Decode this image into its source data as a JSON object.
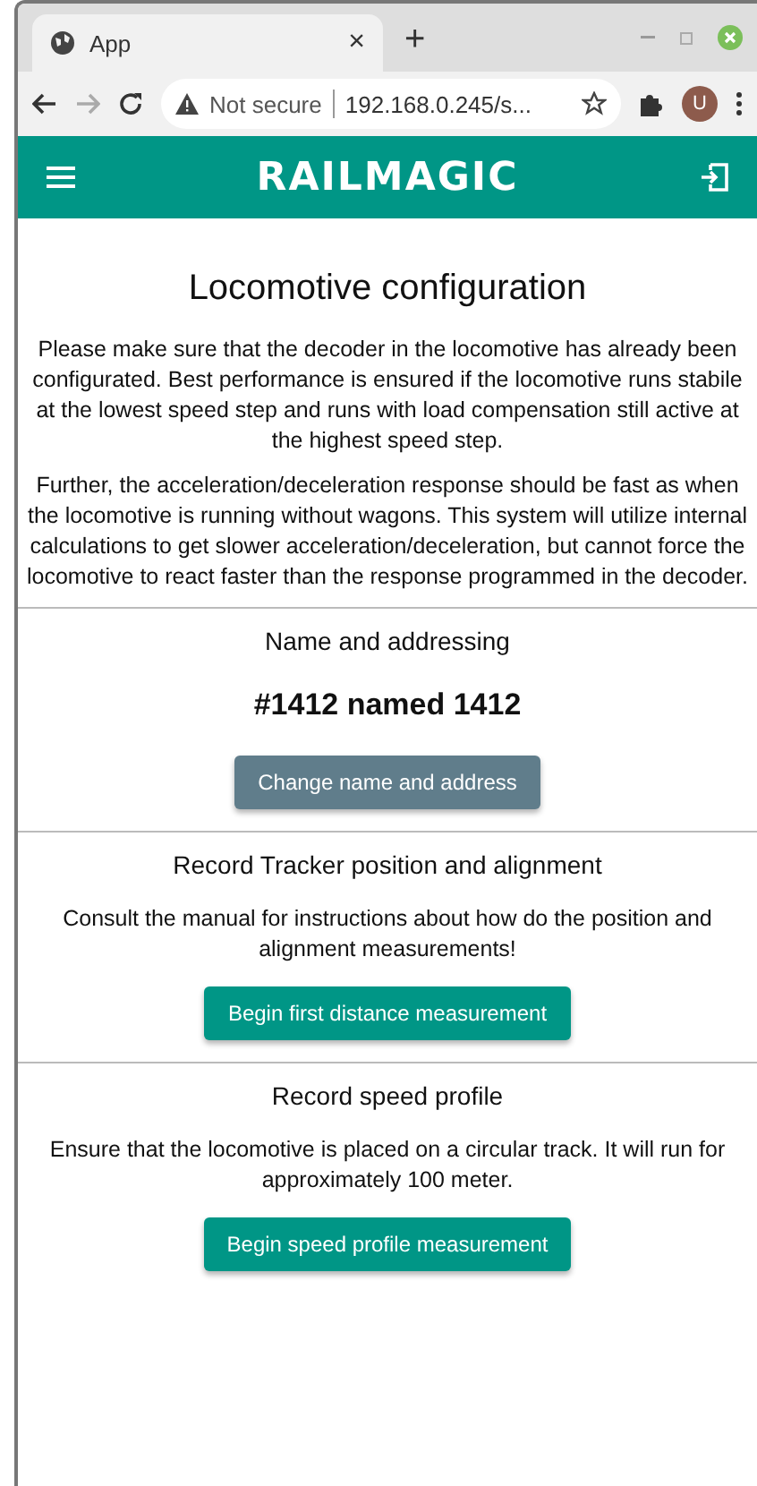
{
  "browser": {
    "tab": {
      "title": "App",
      "close": "×"
    },
    "new_tab": "+",
    "address": {
      "security": "Not secure",
      "url": "192.168.0.245/s..."
    },
    "profile": "U"
  },
  "app_bar": {
    "logo": "RAILMAGIC"
  },
  "page": {
    "title": "Locomotive configuration",
    "paragraphs": [
      "Please make sure that the decoder in the locomotive has already been configurated. Best performance is ensured if the locomotive runs stabile at the lowest speed step and runs with load compensation still active at the highest speed step.",
      "Further, the acceleration/deceleration response should be fast as when the locomotive is running without wagons. This system will utilize internal calculations to get slower acceleration/deceleration, but cannot force the locomotive to react faster than the response programmed in the decoder."
    ],
    "sections": [
      {
        "heading": "Name and addressing",
        "value": "#1412 named 1412",
        "button": {
          "label": "Change name and address",
          "kind": "secondary"
        }
      },
      {
        "heading": "Record Tracker position and alignment",
        "text": "Consult the manual for instructions about how do the position and alignment measurements!",
        "button": {
          "label": "Begin first distance measurement",
          "kind": "primary"
        }
      },
      {
        "heading": "Record speed profile",
        "text": "Ensure that the locomotive is placed on a circular track. It will run for approximately 100 meter.",
        "button": {
          "label": "Begin speed profile measurement",
          "kind": "primary"
        }
      }
    ]
  }
}
